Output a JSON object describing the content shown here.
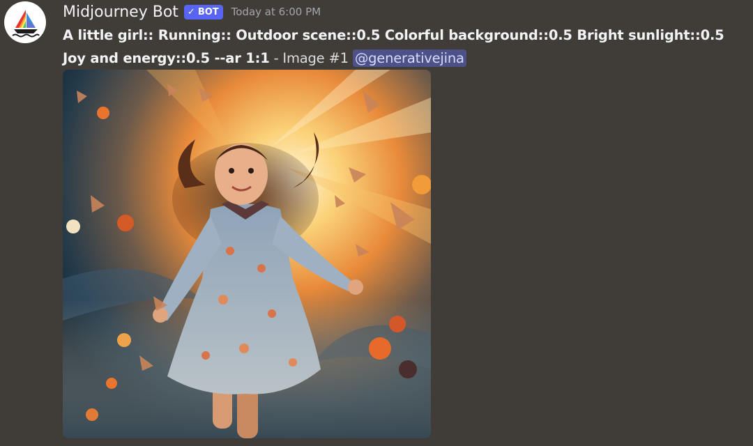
{
  "message": {
    "author": {
      "name": "Midjourney Bot",
      "avatar_icon": "sailboat-logo-icon",
      "tag": {
        "icon": "check-icon",
        "label": "BOT",
        "color": "#5865f2"
      }
    },
    "timestamp": "Today at 6:00 PM",
    "prompt": "A little girl:: Running:: Outdoor scene::0.5 Colorful background::0.5 Bright sunlight::0.5 Joy and energy::0.5 --ar 1:1",
    "suffix": " - Image #1 ",
    "mention": "@generativejina",
    "attachment": {
      "image_subject": "painting of a smiling little girl with flowing brown hair running in a floral dress amid butterflies and flowers with bright sunlight behind her"
    }
  },
  "colors": {
    "background": "#403d39",
    "mention_bg": "#4d5187",
    "mention_text": "#d6dbff"
  }
}
